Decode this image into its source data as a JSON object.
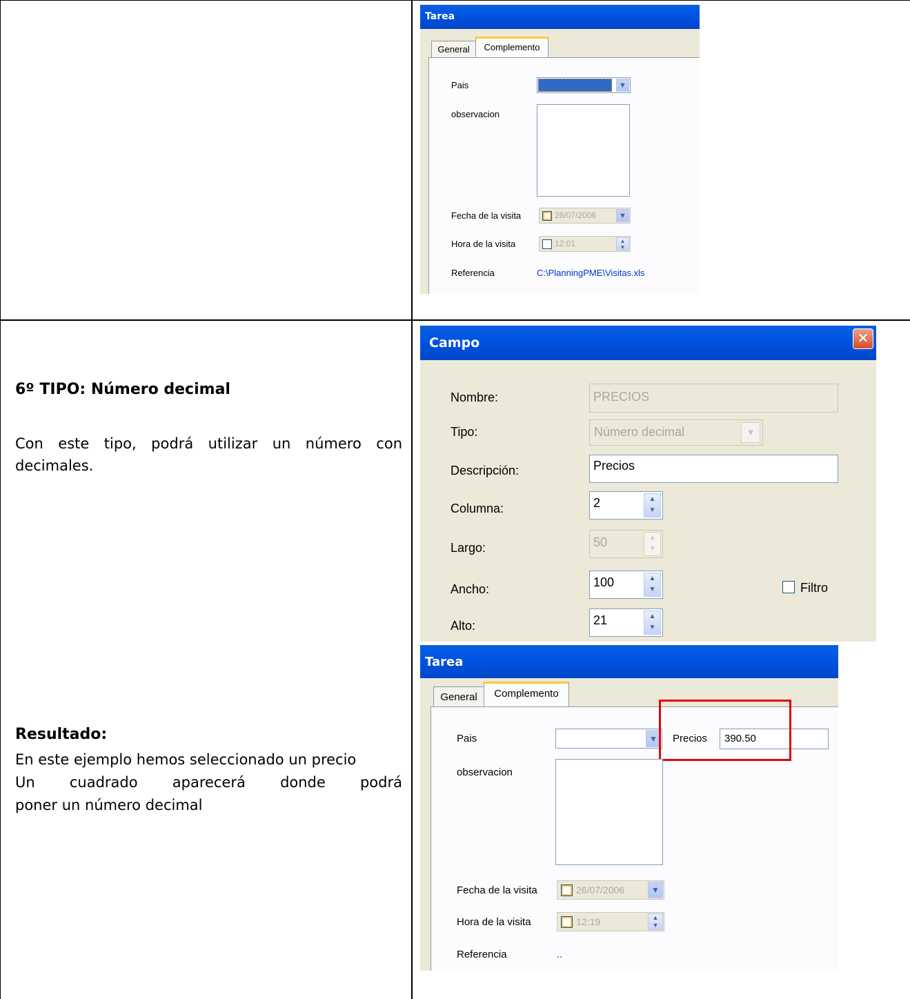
{
  "left_column": {
    "section_title": "6º TIPO: Número decimal",
    "section_text": "Con este tipo, podrá utilizar un número con decimales.",
    "section_text_line1": "Con este tipo, podrá utilizar un número con",
    "section_text_line2": "decimales.",
    "result_title": "Resultado:",
    "result_line1": "En este ejemplo hemos seleccionado un precio",
    "result_line2": "Un cuadrado aparecerá donde podrá",
    "result_line3": "poner un número decimal"
  },
  "tarea_top": {
    "title": "Tarea",
    "tabs": [
      "General",
      "Complemento"
    ],
    "active_tab": "Complemento",
    "pais_label": "Pais",
    "observacion_label": "observacion",
    "fecha_label": "Fecha de la visita",
    "fecha_value": "26/07/2006",
    "hora_label": "Hora de la visita",
    "hora_value": "12:01",
    "referencia_label": "Referencia",
    "referencia_value": "C:\\PlanningPME\\Visitas.xls"
  },
  "campo": {
    "title": "Campo",
    "close_glyph": "✕",
    "nombre_label": "Nombre:",
    "nombre_value": "PRECIOS",
    "tipo_label": "Tipo:",
    "tipo_value": "Número decimal",
    "descripcion_label": "Descripción:",
    "descripcion_value": "Precios",
    "columna_label": "Columna:",
    "columna_value": "2",
    "largo_label": "Largo:",
    "largo_value": "50",
    "ancho_label": "Ancho:",
    "ancho_value": "100",
    "filtro_label": "Filtro",
    "alto_label": "Alto:",
    "alto_value": "21"
  },
  "tarea_bottom": {
    "title": "Tarea",
    "tabs": [
      "General",
      "Complemento"
    ],
    "active_tab": "Complemento",
    "pais_label": "Pais",
    "precios_label": "Precios",
    "precios_value": "390.50",
    "observacion_label": "observacion",
    "fecha_label": "Fecha de la visita",
    "fecha_value": "26/07/2006",
    "hora_label": "Hora de la visita",
    "hora_value": "12:19",
    "referencia_label": "Referencia",
    "referencia_value": ".."
  },
  "icons": {
    "dropdown": "chevron-down-icon",
    "spinner": "spinner-icon",
    "close": "close-icon",
    "checkbox": "checkbox-icon"
  },
  "colors": {
    "titlebar": "#0054E3",
    "dialog_bg": "#ECE9D8",
    "highlight_red": "#E3000F",
    "selection_blue": "#316AC5",
    "link_blue": "#0033CC"
  }
}
